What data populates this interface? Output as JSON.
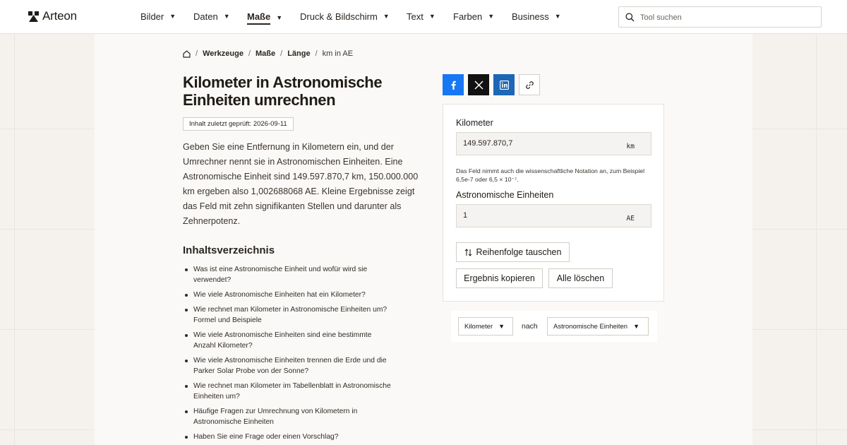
{
  "header": {
    "logo_text": "Arteon",
    "nav": [
      "Bilder",
      "Daten",
      "Maße",
      "Druck & Bildschirm",
      "Text",
      "Farben",
      "Business"
    ],
    "active_nav": "Maße",
    "search_placeholder": "Tool suchen"
  },
  "breadcrumb": {
    "items": [
      "Werkzeuge",
      "Maße",
      "Länge"
    ],
    "current": "km in AE"
  },
  "page": {
    "title": "Kilometer in Astronomische Einheiten umrechnen",
    "checked_badge": "Inhalt zuletzt geprüft: 2026-09-11",
    "intro": "Geben Sie eine Entfernung in Kilometern ein, und der Umrechner nennt sie in Astronomischen Einheiten. Eine Astronomische Einheit sind 149.597.870,7 km, 150.000.000 km ergeben also 1,002688068 AE. Kleine Ergebnisse zeigt das Feld mit zehn signifikanten Stellen und darunter als Zehnerpotenz."
  },
  "toc": {
    "title": "Inhaltsverzeichnis",
    "items": [
      "Was ist eine Astronomische Einheit und wofür wird sie verwendet?",
      "Wie viele Astronomische Einheiten hat ein Kilometer?",
      "Wie rechnet man Kilometer in Astronomische Einheiten um? Formel und Beispiele",
      "Wie viele Astronomische Einheiten sind eine bestimmte Anzahl Kilometer?",
      "Wie viele Astronomische Einheiten trennen die Erde und die Parker Solar Probe von der Sonne?",
      "Wie rechnet man Kilometer im Tabellenblatt in Astronomische Einheiten um?",
      "Häufige Fragen zur Umrechnung von Kilometern in Astronomische Einheiten",
      "Haben Sie eine Frage oder einen Vorschlag?"
    ]
  },
  "converter": {
    "from_label": "Kilometer",
    "from_value": "149.597.870,7",
    "from_unit": "km",
    "hint": "Das Feld nimmt auch die wissenschaftliche Notation an, zum Beispiel 6,5e-7 oder 6,5 × 10⁻⁷.",
    "to_label": "Astronomische Einheiten",
    "to_value": "1",
    "to_unit": "AE",
    "swap_label": "Reihenfolge tauschen",
    "copy_label": "Ergebnis kopieren",
    "clear_label": "Alle löschen"
  },
  "unit_select": {
    "from": "Kilometer",
    "joiner": "nach",
    "to": "Astronomische Einheiten"
  },
  "colors": {
    "facebook": "#1877f2",
    "x": "#121212",
    "linkedin": "#1e66b6",
    "background": "#f5f2ee"
  }
}
